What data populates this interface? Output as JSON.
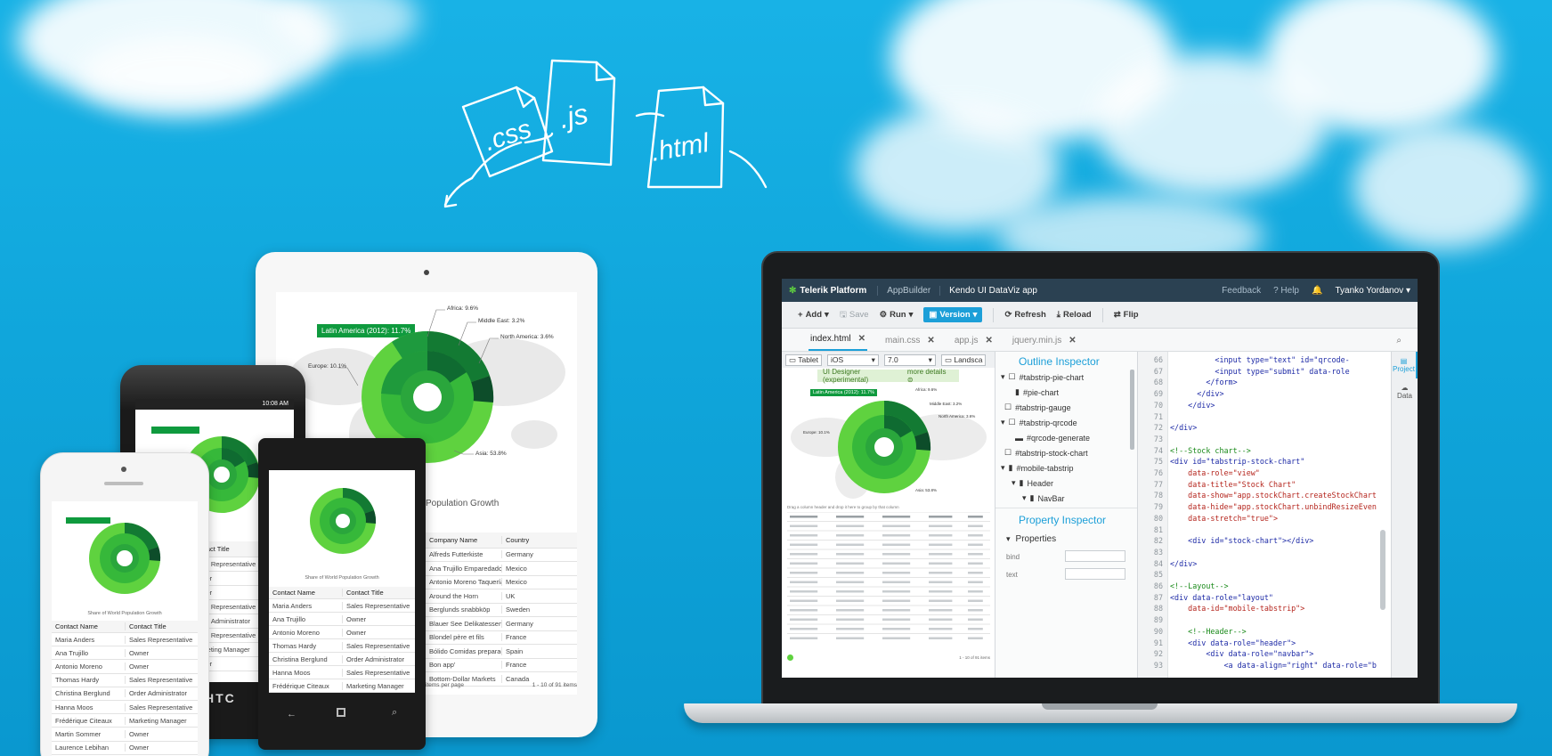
{
  "scene": {
    "sky_color": "#12aade",
    "accent_green": "#4cc93c",
    "ide_topbar_color": "#2b4152",
    "ide_accent": "#1c9fd8"
  },
  "sketch": {
    "files": [
      ".css",
      ".js",
      ".html"
    ]
  },
  "laptop": {
    "topbar": {
      "brand": "Telerik Platform",
      "crumb": "AppBuilder",
      "project": "Kendo UI DataViz app",
      "feedback": "Feedback",
      "help": "Help",
      "user": "Tyanko Yordanov"
    },
    "toolbar": {
      "add": "Add",
      "save": "Save",
      "run": "Run",
      "version": "Version",
      "refresh": "Refresh",
      "reload": "Reload",
      "flip": "Flip"
    },
    "tabs": [
      "index.html",
      "main.css",
      "app.js",
      "jquery.min.js"
    ],
    "designer": {
      "device": "Tablet",
      "os": "iOS",
      "version": "7.0",
      "orientation": "Landsca",
      "banner": "UI Designer (experimental)",
      "more": "more details",
      "chart_label": "Latin America (2012): 11.7%",
      "legend": {
        "africa": "Africa: 9.6%",
        "middle_east": "Middle East: 3.2%",
        "north_america": "North America: 3.6%",
        "europe": "Europe: 10.1%",
        "asia": "Asia: 53.8%"
      },
      "table_caption": "Drag a column header and drop it here to group by that column",
      "page_info": "1 - 10 of 91 items"
    },
    "outline": {
      "title": "Outline Inspector",
      "items": [
        "#tabstrip-pie-chart",
        "#pie-chart",
        "#tabstrip-gauge",
        "#tabstrip-qrcode",
        "#qrcode-generate",
        "#tabstrip-stock-chart",
        "#mobile-tabstrip",
        "Header",
        "NavBar"
      ],
      "property_title": "Property Inspector",
      "properties_label": "Properties",
      "bind": "bind",
      "text": "text"
    },
    "editor": {
      "lines": [
        {
          "n": "66",
          "code": "          <input type=\"text\" id=\"qrcode-"
        },
        {
          "n": "67",
          "code": "          <input type=\"submit\" data-role"
        },
        {
          "n": "68",
          "code": "        </form>"
        },
        {
          "n": "69",
          "code": "      </div>"
        },
        {
          "n": "70",
          "code": "    </div>"
        },
        {
          "n": "71",
          "code": ""
        },
        {
          "n": "72",
          "code": "</div>"
        },
        {
          "n": "73",
          "code": ""
        },
        {
          "n": "74",
          "code": "<!--Stock chart-->"
        },
        {
          "n": "75",
          "code": "<div id=\"tabstrip-stock-chart\""
        },
        {
          "n": "76",
          "code": "    data-role=\"view\""
        },
        {
          "n": "77",
          "code": "    data-title=\"Stock Chart\""
        },
        {
          "n": "78",
          "code": "    data-show=\"app.stockChart.createStockChart"
        },
        {
          "n": "79",
          "code": "    data-hide=\"app.stockChart.unbindResizeEven"
        },
        {
          "n": "80",
          "code": "    data-stretch=\"true\">"
        },
        {
          "n": "81",
          "code": ""
        },
        {
          "n": "82",
          "code": "    <div id=\"stock-chart\"></div>"
        },
        {
          "n": "83",
          "code": ""
        },
        {
          "n": "84",
          "code": "</div>"
        },
        {
          "n": "85",
          "code": ""
        },
        {
          "n": "86",
          "code": "<!--Layout-->"
        },
        {
          "n": "87",
          "code": "<div data-role=\"layout\""
        },
        {
          "n": "88",
          "code": "    data-id=\"mobile-tabstrip\">"
        },
        {
          "n": "89",
          "code": ""
        },
        {
          "n": "90",
          "code": "    <!--Header-->"
        },
        {
          "n": "91",
          "code": "    <div data-role=\"header\">"
        },
        {
          "n": "92",
          "code": "        <div data-role=\"navbar\">"
        },
        {
          "n": "93",
          "code": "            <a data-align=\"right\" data-role=\"b"
        }
      ]
    },
    "sidetabs": [
      "Project",
      "Data"
    ]
  },
  "ipad": {
    "chart_label": "Latin America (2012): 11.7%",
    "legend": {
      "africa": "Africa: 9.6%",
      "middle_east": "Middle East: 3.2%",
      "north_america": "North America: 3.6%",
      "europe": "Europe: 10.1%",
      "asia": "Asia: 53.8%"
    },
    "section_title": "Population Growth",
    "table_headers": [
      "Company Name",
      "Country"
    ],
    "rows": [
      [
        "Alfreds Futterkiste",
        "Germany"
      ],
      [
        "Ana Trujillo Emparedados y helados",
        "Mexico"
      ],
      [
        "Antonio Moreno Taquería",
        "Mexico"
      ],
      [
        "Around the Horn",
        "UK"
      ],
      [
        "Berglunds snabbköp",
        "Sweden"
      ],
      [
        "Blauer See Delikatessen",
        "Germany"
      ],
      [
        "Blondel père et fils",
        "France"
      ],
      [
        "Bólido Comidas preparadas",
        "Spain"
      ],
      [
        "Bon app'",
        "France"
      ],
      [
        "Bottom-Dollar Markets",
        "Canada"
      ]
    ],
    "pager": {
      "per_page": "items per page",
      "info": "1 - 10 of 91 items"
    }
  },
  "htc": {
    "status_time": "10:08 AM",
    "brand": "HTC",
    "table_header": "Contact Title",
    "rows": [
      "Sales Representative",
      "Owner",
      "Owner",
      "Sales Representative",
      "Order Administrator",
      "Sales Representative",
      "Marketing Manager",
      "Owner"
    ]
  },
  "lumia": {
    "chart_caption": "Share of World Population Growth",
    "table_headers": [
      "Contact Name",
      "Contact Title"
    ],
    "rows": [
      [
        "Maria Anders",
        "Sales Representative"
      ],
      [
        "Ana Trujillo",
        "Owner"
      ],
      [
        "Antonio Moreno",
        "Owner"
      ],
      [
        "Thomas Hardy",
        "Sales Representative"
      ],
      [
        "Christina Berglund",
        "Order Administrator"
      ],
      [
        "Hanna Moos",
        "Sales Representative"
      ],
      [
        "Frédérique Citeaux",
        "Marketing Manager"
      ]
    ]
  },
  "iphone": {
    "chart_caption": "Share of World Population Growth",
    "table_headers": [
      "Contact Name",
      "Contact Title"
    ],
    "rows": [
      [
        "Maria Anders",
        "Sales Representative"
      ],
      [
        "Ana Trujillo",
        "Owner"
      ],
      [
        "Antonio Moreno",
        "Owner"
      ],
      [
        "Thomas Hardy",
        "Sales Representative"
      ],
      [
        "Christina Berglund",
        "Order Administrator"
      ],
      [
        "Hanna Moos",
        "Sales Representative"
      ],
      [
        "Frédérique Citeaux",
        "Marketing Manager"
      ],
      [
        "Martin Sommer",
        "Owner"
      ],
      [
        "Laurence Lebihan",
        "Owner"
      ]
    ]
  }
}
